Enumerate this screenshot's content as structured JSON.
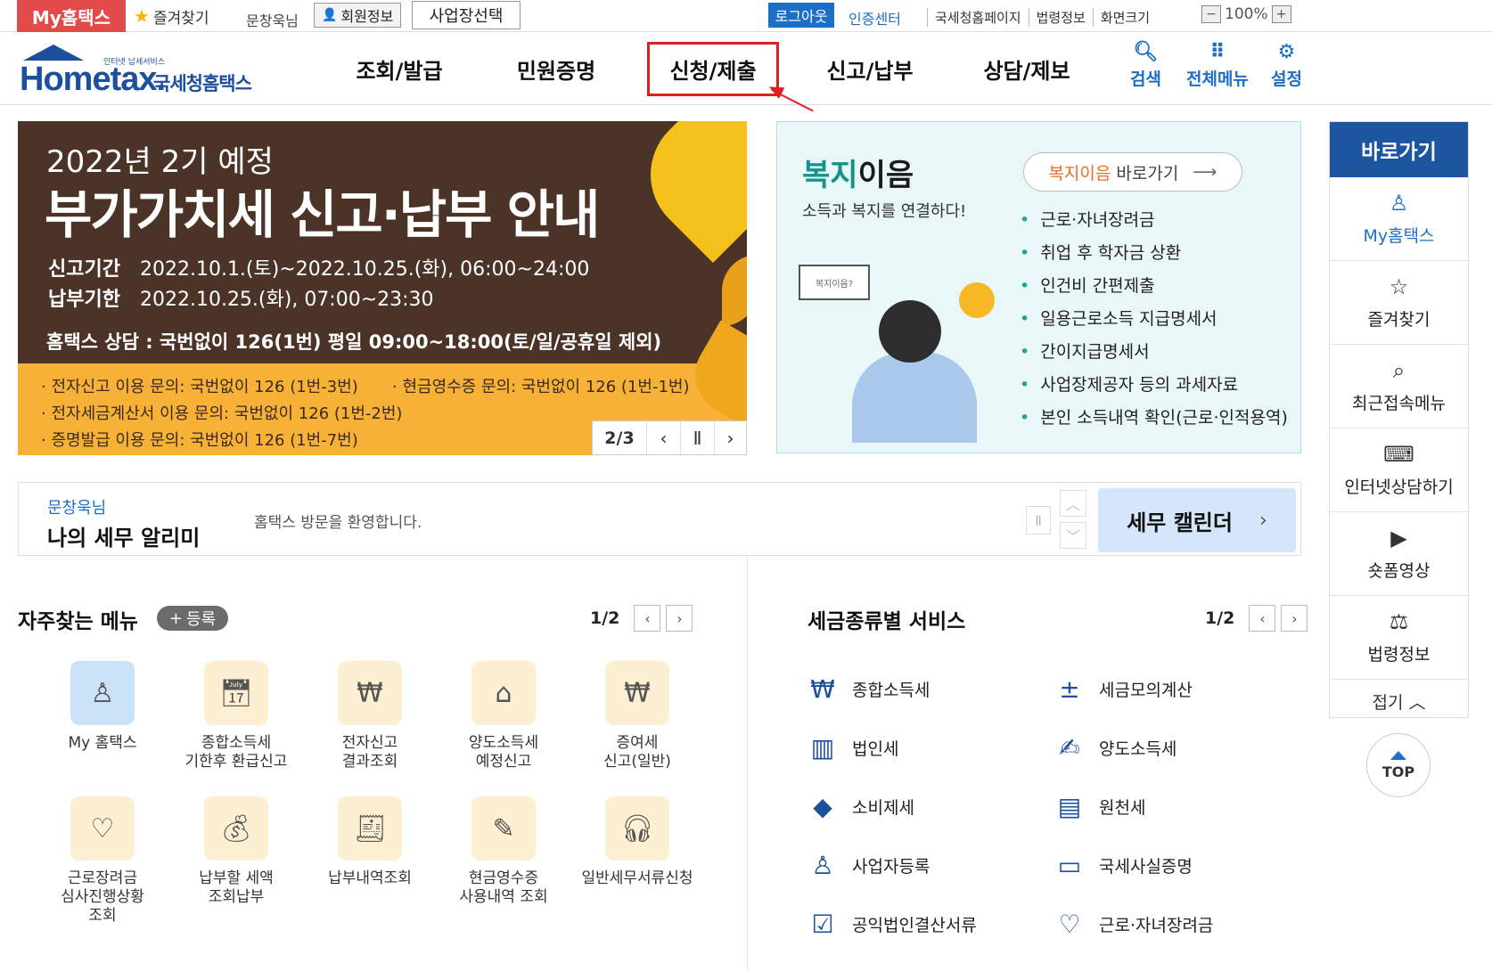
{
  "topbar": {
    "my_hometax": "My홈택스",
    "favorites": "즐겨찾기",
    "username": "문창욱님",
    "member_info": "회원정보",
    "business_select": "사업장선택",
    "logout": "로그아웃",
    "cert_center": "인증센터",
    "links": [
      "국세청홈페이지",
      "법령정보",
      "화면크기"
    ],
    "zoom_minus": "−",
    "zoom_level": "100%",
    "zoom_plus": "+"
  },
  "header": {
    "logo_small": "인터넷 납세서비스",
    "logo_main": "Hometax.",
    "logo_sub": "국세청홈택스",
    "nav": [
      "조회/발급",
      "민원증명",
      "신청/제출",
      "신고/납부",
      "상담/제보"
    ],
    "highlighted_nav_index": 2,
    "tools": {
      "search": "검색",
      "all_menu": "전체메뉴",
      "settings": "설정"
    }
  },
  "banner": {
    "subtitle": "2022년 2기 예정",
    "title": "부가가치세 신고·납부 안내",
    "period_label": "신고기간",
    "period_value": "2022.10.1.(토)~2022.10.25.(화), 06:00~24:00",
    "pay_label": "납부기한",
    "pay_value": "2022.10.25.(화), 07:00~23:30",
    "contact": "홈택스 상담 : 국번없이 126(1번) 평일 09:00~18:00(토/일/공휴일 제외)",
    "lines": [
      "· 전자신고 이용 문의: 국번없이 126 (1번-3번)",
      "· 현금영수증 문의: 국번없이 126 (1번-1번)",
      "· 전자세금계산서 이용 문의: 국번없이 126 (1번-2번)",
      "· 증명발급 이용 문의: 국번없이 126 (1번-7번)"
    ],
    "page": "2/3",
    "prev": "‹",
    "pause": "Ⅱ",
    "next": "›"
  },
  "welfare": {
    "title_green": "복지",
    "title_rest": "이음",
    "subtitle": "소득과 복지를 연결하다!",
    "link_green": "복지이음",
    "link_rest": "바로가기",
    "link_arrow": "⟶",
    "sign_text": "복지이음?",
    "items": [
      "근로·자녀장려금",
      "취업 후 학자금 상환",
      "인건비 간편제출",
      "일용근로소득 지급명세서",
      "간이지급명세서",
      "사업장제공자 등의 과세자료",
      "본인 소득내역 확인(근로·인적용역)"
    ]
  },
  "quick": {
    "title": "바로가기",
    "items": [
      {
        "label": "My홈택스",
        "icon": "person-icon"
      },
      {
        "label": "즐겨찾기",
        "icon": "star-icon"
      },
      {
        "label": "최근접속메뉴",
        "icon": "recent-search-icon"
      },
      {
        "label": "인터넷상담하기",
        "icon": "laptop-check-icon"
      },
      {
        "label": "숏폼영상",
        "icon": "play-icon"
      },
      {
        "label": "법령정보",
        "icon": "gavel-icon"
      }
    ],
    "fold": "접기",
    "fold_arrow": "︿",
    "top": "TOP"
  },
  "notice": {
    "name": "문창욱님",
    "title": "나의 세무 알리미",
    "message": "홈택스 방문을 환영합니다.",
    "pause": "Ⅱ",
    "up": "︿",
    "down": "﹀",
    "calendar": "세무 캘린더",
    "calendar_arrow": "›"
  },
  "frequent": {
    "title": "자주찾는 메뉴",
    "register": "등록",
    "register_plus": "+",
    "page": "1/2",
    "prev": "‹",
    "next": "›",
    "items": [
      {
        "label": "My 홈택스",
        "icon": "person-icon"
      },
      {
        "label": "종합소득세\n기한후 환급신고",
        "icon": "calendar-edit-icon"
      },
      {
        "label": "전자신고\n결과조회",
        "icon": "won-search-icon"
      },
      {
        "label": "양도소득세\n예정신고",
        "icon": "house-icon"
      },
      {
        "label": "증여세\n신고(일반)",
        "icon": "won-gift-icon"
      },
      {
        "label": "근로장려금\n심사진행상황\n조회",
        "icon": "heart-search-icon"
      },
      {
        "label": "납부할 세액\n조회납부",
        "icon": "money-bag-icon"
      },
      {
        "label": "납부내역조회",
        "icon": "receipt-search-icon"
      },
      {
        "label": "현금영수증\n사용내역 조회",
        "icon": "receipt-edit-icon"
      },
      {
        "label": "일반세무서류신청",
        "icon": "headset-icon"
      }
    ]
  },
  "tax": {
    "title": "세금종류별 서비스",
    "page": "1/2",
    "prev": "‹",
    "next": "›",
    "items": [
      {
        "label": "종합소득세",
        "icon": "piggy-won-icon"
      },
      {
        "label": "세금모의계산",
        "icon": "calculator-icon"
      },
      {
        "label": "법인세",
        "icon": "building-icon"
      },
      {
        "label": "양도소득세",
        "icon": "document-edit-icon"
      },
      {
        "label": "소비제세",
        "icon": "diamond-icon"
      },
      {
        "label": "원천세",
        "icon": "salary-doc-icon"
      },
      {
        "label": "사업자등록",
        "icon": "person-icon"
      },
      {
        "label": "국세사실증명",
        "icon": "document-icon"
      },
      {
        "label": "공익법인결산서류",
        "icon": "clipboard-check-icon"
      },
      {
        "label": "근로·자녀장려금",
        "icon": "heart-hand-icon"
      }
    ]
  },
  "colors": {
    "brand_blue": "#1c4f9c",
    "link_blue": "#1c6fc4",
    "my_red": "#e34b4b",
    "highlight_red": "#e01f1f",
    "welfare_green": "#12948a"
  }
}
